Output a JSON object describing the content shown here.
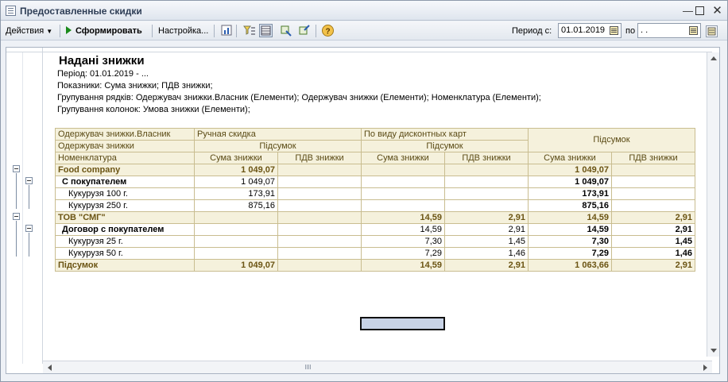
{
  "window": {
    "title": "Предоставленные скидки"
  },
  "toolbar": {
    "actions_label": "Действия",
    "generate_label": "Сформировать",
    "settings_label": "Настройка...",
    "period_from_label": "Период с:",
    "period_from_value": "01.01.2019",
    "period_to_label": "по",
    "period_to_value": " .  ."
  },
  "report": {
    "title": "Надані знижки",
    "lines": [
      "Період: 01.01.2019 - ...",
      "Показники: Сума знижки; ПДВ знижки;",
      "Групування рядків: Одержувач знижки.Власник (Елементи); Одержувач знижки (Елементи); Номенклатура (Елементи);",
      "Групування колонок: Умова знижки (Елементи);"
    ],
    "header": {
      "row1": {
        "col0": "Одержувач знижки.Власник",
        "g1": "Ручная скидка",
        "g2": "По виду дисконтных карт",
        "total": "Підсумок"
      },
      "row2": {
        "col0": "Одержувач знижки",
        "g1": "Підсумок",
        "g2": "Підсумок"
      },
      "row3": {
        "col0": "Номенклатура",
        "m1": "Сума знижки",
        "m2": "ПДВ знижки",
        "m3": "Сума знижки",
        "m4": "ПДВ знижки",
        "m5": "Сума знижки",
        "m6": "ПДВ знижки"
      }
    },
    "rows": [
      {
        "name": "Food company",
        "v": [
          "1 049,07",
          "",
          "",
          "",
          "1 049,07",
          ""
        ]
      },
      {
        "name": "С покупателем",
        "v": [
          "1 049,07",
          "",
          "",
          "",
          "1 049,07",
          ""
        ]
      },
      {
        "name": "Кукурузя 100 г.",
        "v": [
          "173,91",
          "",
          "",
          "",
          "173,91",
          ""
        ]
      },
      {
        "name": "Кукурузя 250 г.",
        "v": [
          "875,16",
          "",
          "",
          "",
          "875,16",
          ""
        ]
      },
      {
        "name": "ТОВ \"СМГ\"",
        "v": [
          "",
          "",
          "14,59",
          "2,91",
          "14,59",
          "2,91"
        ]
      },
      {
        "name": "Договор с покупателем",
        "v": [
          "",
          "",
          "14,59",
          "2,91",
          "14,59",
          "2,91"
        ]
      },
      {
        "name": "Кукурузя 25 г.",
        "v": [
          "",
          "",
          "7,30",
          "1,45",
          "7,30",
          "1,45"
        ]
      },
      {
        "name": "Кукурузя 50 г.",
        "v": [
          "",
          "",
          "7,29",
          "1,46",
          "7,29",
          "1,46"
        ]
      },
      {
        "name": "Підсумок",
        "v": [
          "1 049,07",
          "",
          "14,59",
          "2,91",
          "1 063,66",
          "2,91"
        ]
      }
    ]
  }
}
